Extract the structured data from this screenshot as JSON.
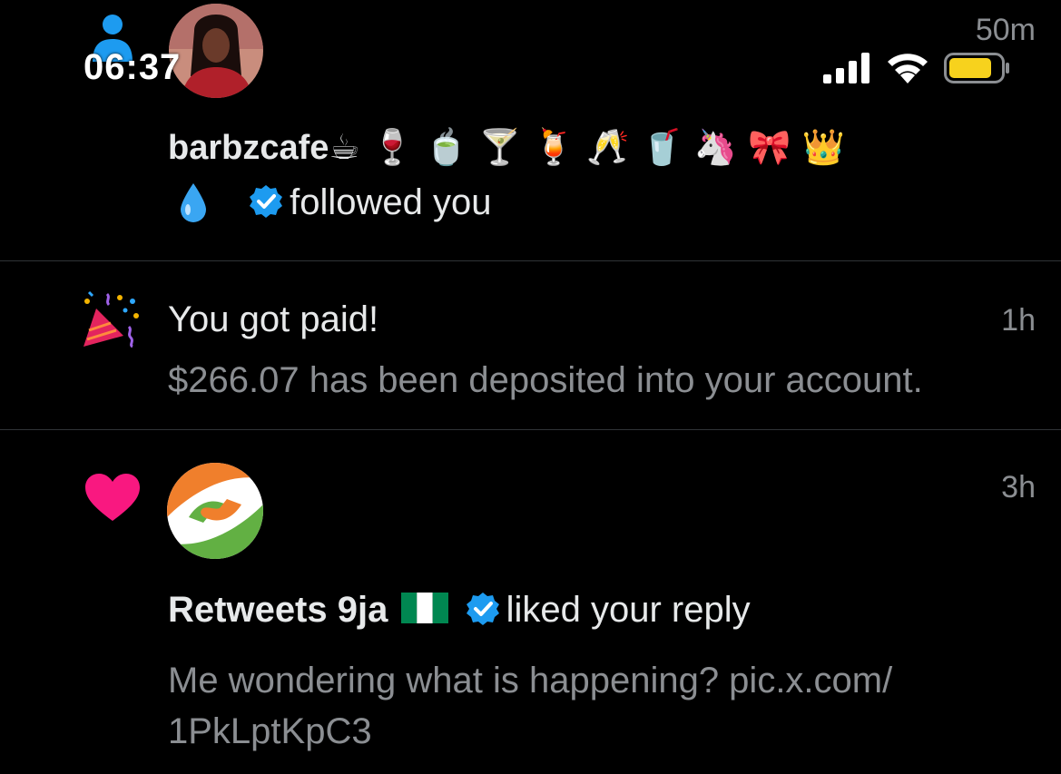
{
  "status_bar": {
    "time": "06:37",
    "elapsed": "50m",
    "battery_color": "#f7d21d"
  },
  "notifications": [
    {
      "type": "follow",
      "username": "barbzcafe",
      "name_emojis": "☕ 🍷 🍵 🍸 🍹 🥂 🥤 🦄 🎀 👑",
      "verified": true,
      "action": "followed you",
      "icon": "droplet-icon"
    },
    {
      "type": "payment",
      "icon": "party-popper-icon",
      "title": "You got paid!",
      "time": "1h",
      "body": "$266.07 has been deposited into your account."
    },
    {
      "type": "like",
      "icon": "heart-icon",
      "heart_color": "#f91880",
      "time": "3h",
      "username": "Retweets 9ja",
      "verified": true,
      "action": "liked your reply",
      "reply_text": "Me wondering what is happening? pic.x.com/ 1PkLptKpC3"
    }
  ],
  "colors": {
    "background": "#000000",
    "text_primary": "#e7e9ea",
    "text_secondary": "#8b8e92",
    "verified_blue": "#1d9bf0",
    "divider": "#2f3336"
  }
}
